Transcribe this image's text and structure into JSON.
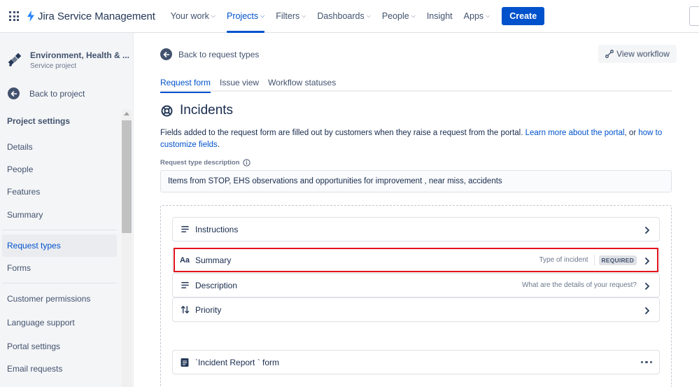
{
  "topnav": {
    "brand": "Jira Service Management",
    "links": [
      {
        "label": "Your work",
        "chevron": true,
        "active": false
      },
      {
        "label": "Projects",
        "chevron": true,
        "active": true
      },
      {
        "label": "Filters",
        "chevron": true,
        "active": false
      },
      {
        "label": "Dashboards",
        "chevron": true,
        "active": false
      },
      {
        "label": "People",
        "chevron": true,
        "active": false
      },
      {
        "label": "Insight",
        "chevron": false,
        "active": false
      },
      {
        "label": "Apps",
        "chevron": true,
        "active": false
      }
    ],
    "create_label": "Create"
  },
  "sidebar": {
    "project_name": "Environment, Health & ...",
    "project_type": "Service project",
    "back_label": "Back to project",
    "section_title": "Project settings",
    "items": [
      {
        "label": "Details",
        "active": false
      },
      {
        "label": "People",
        "active": false
      },
      {
        "label": "Features",
        "active": false
      },
      {
        "label": "Summary",
        "active": false
      },
      {
        "label": "Request types",
        "active": true
      },
      {
        "label": "Forms",
        "active": false
      },
      {
        "label": "Customer permissions",
        "active": false
      },
      {
        "label": "Language support",
        "active": false
      },
      {
        "label": "Portal settings",
        "active": false
      },
      {
        "label": "Email requests",
        "active": false
      }
    ]
  },
  "main": {
    "back_label": "Back to request types",
    "view_workflow_label": "View workflow",
    "tabs": [
      {
        "label": "Request form",
        "active": true
      },
      {
        "label": "Issue view",
        "active": false
      },
      {
        "label": "Workflow statuses",
        "active": false
      }
    ],
    "title": "Incidents",
    "intro_text": "Fields added to the request form are filled out by customers when they raise a request from the portal. ",
    "intro_link1": "Learn more about the portal",
    "intro_mid": ", or ",
    "intro_link2": "how to customize fields",
    "intro_end": ".",
    "desc_label": "Request type description",
    "desc_value": "Items from STOP, EHS observations and opportunities for improvement , near miss, accidents",
    "fields": [
      {
        "name": "Instructions",
        "icon": "text-lines-icon",
        "hint": "",
        "required": false
      },
      {
        "name": "Summary",
        "icon": "text-format-icon",
        "icon_glyph": "Aa",
        "hint": "Type of incident",
        "required": true,
        "required_label": "REQUIRED"
      },
      {
        "name": "Description",
        "icon": "text-lines-icon",
        "hint": "What are the details of your request?",
        "required": false
      },
      {
        "name": "Priority",
        "icon": "sort-arrows-icon",
        "hint": "",
        "required": false
      }
    ],
    "form_item": "`Incident Report ` form"
  },
  "colors": {
    "accent": "#0052cc",
    "highlight": "#e3141c",
    "sidebar_bg": "#f4f5f7"
  }
}
